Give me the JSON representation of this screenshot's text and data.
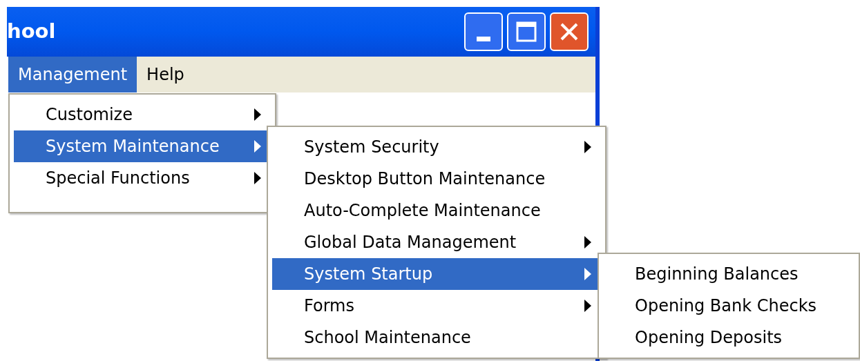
{
  "window": {
    "title": "hool"
  },
  "menu_bar": [
    {
      "label": "Management",
      "selected": true
    },
    {
      "label": "Help",
      "selected": false
    }
  ],
  "menus": [
    {
      "items": [
        {
          "label": "Customize",
          "submenu": true,
          "selected": false
        },
        {
          "label": "System Maintenance",
          "submenu": true,
          "selected": true
        },
        {
          "label": "Special Functions",
          "submenu": true,
          "selected": false
        }
      ]
    },
    {
      "items": [
        {
          "label": "System Security",
          "submenu": true,
          "selected": false
        },
        {
          "label": "Desktop Button Maintenance",
          "submenu": false,
          "selected": false
        },
        {
          "label": "Auto-Complete Maintenance",
          "submenu": false,
          "selected": false
        },
        {
          "label": "Global Data Management",
          "submenu": true,
          "selected": false
        },
        {
          "label": "System Startup",
          "submenu": true,
          "selected": true
        },
        {
          "label": "Forms",
          "submenu": true,
          "selected": false
        },
        {
          "label": "School Maintenance",
          "submenu": false,
          "selected": false
        }
      ]
    },
    {
      "items": [
        {
          "label": "Beginning Balances",
          "submenu": false,
          "selected": false
        },
        {
          "label": "Opening Bank Checks",
          "submenu": false,
          "selected": false
        },
        {
          "label": "Opening Deposits",
          "submenu": false,
          "selected": false
        }
      ]
    }
  ]
}
